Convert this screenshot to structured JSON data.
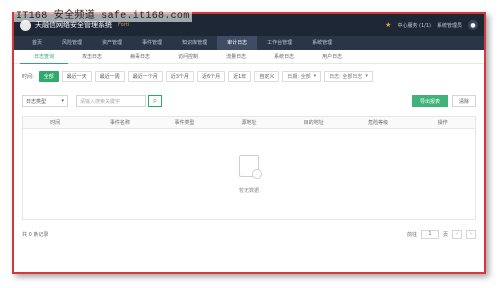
{
  "watermark": "IT168 安全频道 safe.it168.com",
  "app": {
    "title": "天融信网络安全管理系统",
    "version": "Forti"
  },
  "topbar": {
    "status": "中心服务 (1/1)",
    "user": "系统管理员"
  },
  "nav": [
    "首页",
    "风险管理",
    "资产管理",
    "事件管理",
    "知识库管理",
    "审计日志",
    "工作台管理",
    "系统管理"
  ],
  "nav_active": 5,
  "subtabs": [
    "日志查询",
    "攻击日志",
    "病毒日志",
    "访问控制",
    "流量日志",
    "系统日志",
    "用户日志"
  ],
  "subtab_active": 0,
  "filter": {
    "label": "时间:",
    "chips": [
      "全部",
      "最近一天",
      "最近一周",
      "最近一个月",
      "近3个月",
      "近6个月",
      "近1年",
      "自定义"
    ],
    "chip_active": 0,
    "select1": "日期: 全部",
    "select2": "日志: 全部日志"
  },
  "search": {
    "dropdown": "日志类型",
    "placeholder": "请输入搜索关键字",
    "export_label": "导出报表",
    "reset_label": "清除"
  },
  "table": {
    "headers": [
      "时间",
      "事件名称",
      "事件类型",
      "源地址",
      "目的地址",
      "危险等级",
      "操作"
    ],
    "empty_text": "暂无数据"
  },
  "footer": {
    "total": "共 0 条记录",
    "page_label": "前往",
    "page_value": "1",
    "page_suffix": "页"
  }
}
